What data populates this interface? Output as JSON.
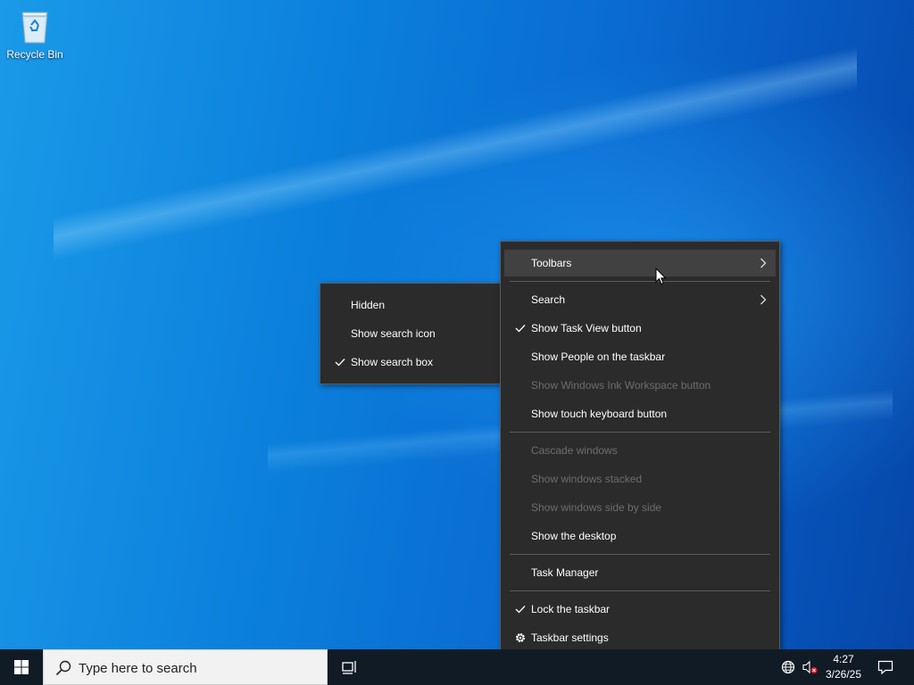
{
  "desktop": {
    "icons": [
      {
        "label": "Recycle Bin",
        "icon": "recycle-bin-icon"
      }
    ]
  },
  "context_menu": {
    "items": [
      {
        "label": "Toolbars",
        "checked": false,
        "disabled": false,
        "submenu": true,
        "highlighted": true
      },
      {
        "label": "Search",
        "checked": false,
        "disabled": false,
        "submenu": true
      },
      {
        "label": "Show Task View button",
        "checked": true,
        "disabled": false
      },
      {
        "label": "Show People on the taskbar",
        "checked": false,
        "disabled": false
      },
      {
        "label": "Show Windows Ink Workspace button",
        "checked": false,
        "disabled": true
      },
      {
        "label": "Show touch keyboard button",
        "checked": false,
        "disabled": false
      },
      {
        "label": "Cascade windows",
        "checked": false,
        "disabled": true
      },
      {
        "label": "Show windows stacked",
        "checked": false,
        "disabled": true
      },
      {
        "label": "Show windows side by side",
        "checked": false,
        "disabled": true
      },
      {
        "label": "Show the desktop",
        "checked": false,
        "disabled": false
      },
      {
        "label": "Task Manager",
        "checked": false,
        "disabled": false
      },
      {
        "label": "Lock the taskbar",
        "checked": true,
        "disabled": false
      },
      {
        "label": "Taskbar settings",
        "icon": "gear-icon",
        "disabled": false
      }
    ]
  },
  "search_submenu": {
    "items": [
      {
        "label": "Hidden",
        "checked": false
      },
      {
        "label": "Show search icon",
        "checked": false
      },
      {
        "label": "Show search box",
        "checked": true
      }
    ]
  },
  "taskbar": {
    "start_icon": "windows-logo-icon",
    "search_placeholder": "Type here to search",
    "task_view_icon": "task-view-icon",
    "tray": {
      "network_icon": "network-globe-icon",
      "volume_icon": "volume-muted-icon",
      "time": "4:27",
      "date": "3/26/25",
      "notification_icon": "action-center-icon"
    }
  },
  "colors": {
    "menu_bg": "#2b2b2b",
    "menu_hover": "#414141",
    "menu_disabled_text": "#6d6d6d",
    "taskbar_bg": "#101b26",
    "wallpaper_blue": "#0b7fdc"
  }
}
